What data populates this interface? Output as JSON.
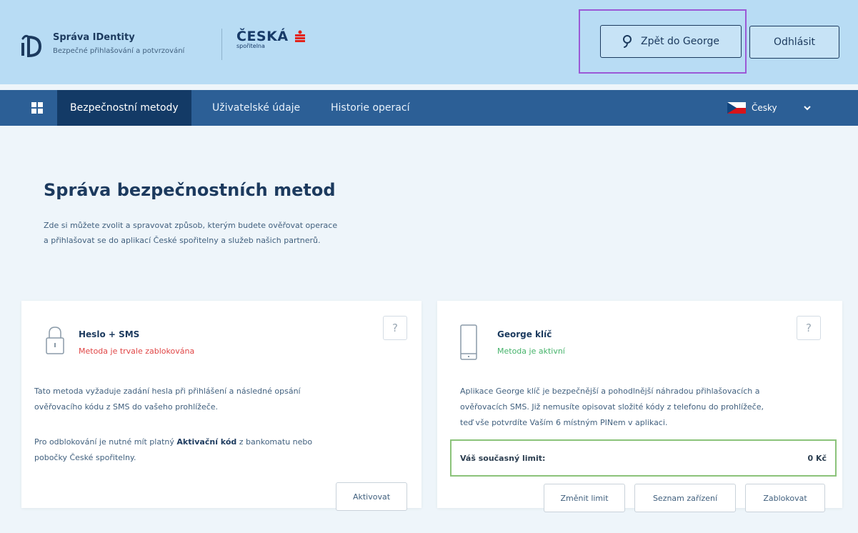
{
  "header": {
    "brand_title": "Správa IDentity",
    "brand_subtitle": "Bezpečné přihlašování a potvrzování",
    "bank_name": "ČESKÁ",
    "bank_sub": "spořitelna",
    "back_button": "Zpět do George",
    "logout_button": "Odhlásit",
    "icons": [
      "id-logo-icon",
      "bank-logo-icon",
      "george-icon"
    ]
  },
  "nav": {
    "items": [
      {
        "label": "Bezpečnostní metody",
        "active": true
      },
      {
        "label": "Uživatelské údaje",
        "active": false
      },
      {
        "label": "Historie operací",
        "active": false
      }
    ],
    "language": "Česky",
    "icons": [
      "grid-icon",
      "czech-flag-icon",
      "chevron-down-icon"
    ]
  },
  "main": {
    "title": "Správa bezpečnostních metod",
    "intro_line1": "Zde si můžete zvolit a spravovat způsob, kterým budete ověřovat operace",
    "intro_line2": "a přihlašovat se do aplikací České spořitelny a služeb našich partnerů."
  },
  "cards": {
    "heslo": {
      "title": "Heslo + SMS",
      "status": "Metoda je trvale zablokována",
      "text1_line1": "Tato metoda vyžaduje zadání hesla při přihlášení a následné opsání",
      "text1_line2": "ověřovacího kódu z SMS do vašeho prohlížeče.",
      "text2_prefix": "Pro odblokování je nutné mít platný",
      "text2_bold": "Aktivační kód",
      "text2_suffix": "z bankomatu nebo",
      "text2_line2": "pobočky České spořitelny.",
      "help": "?",
      "activate_button": "Aktivovat",
      "icon": "lock-icon"
    },
    "george": {
      "title": "George klíč",
      "status": "Metoda je aktivní",
      "text_line1": "Aplikace George klíč je bezpečnější a pohodlnější náhradou přihlašovacích a",
      "text_line2": "ověřovacích SMS. Již nemusíte opisovat složité kódy z telefonu do prohlížeče,",
      "text_line3": "teď vše potvrdíte Vaším 6 místným PINem v aplikaci.",
      "limit_label": "Váš současný limit:",
      "limit_value": "0 Kč",
      "help": "?",
      "change_limit_button": "Změnit limit",
      "devices_button": "Seznam zařízení",
      "block_button": "Zablokovat",
      "icon": "phone-icon"
    }
  },
  "colors": {
    "header_bg": "#b8dcf4",
    "nav_bg": "#2c5f96",
    "nav_active": "#133a66",
    "status_red": "#e04646",
    "status_green": "#45b36a",
    "highlight_purple": "#9b59d6",
    "highlight_green": "#8bc37a"
  }
}
